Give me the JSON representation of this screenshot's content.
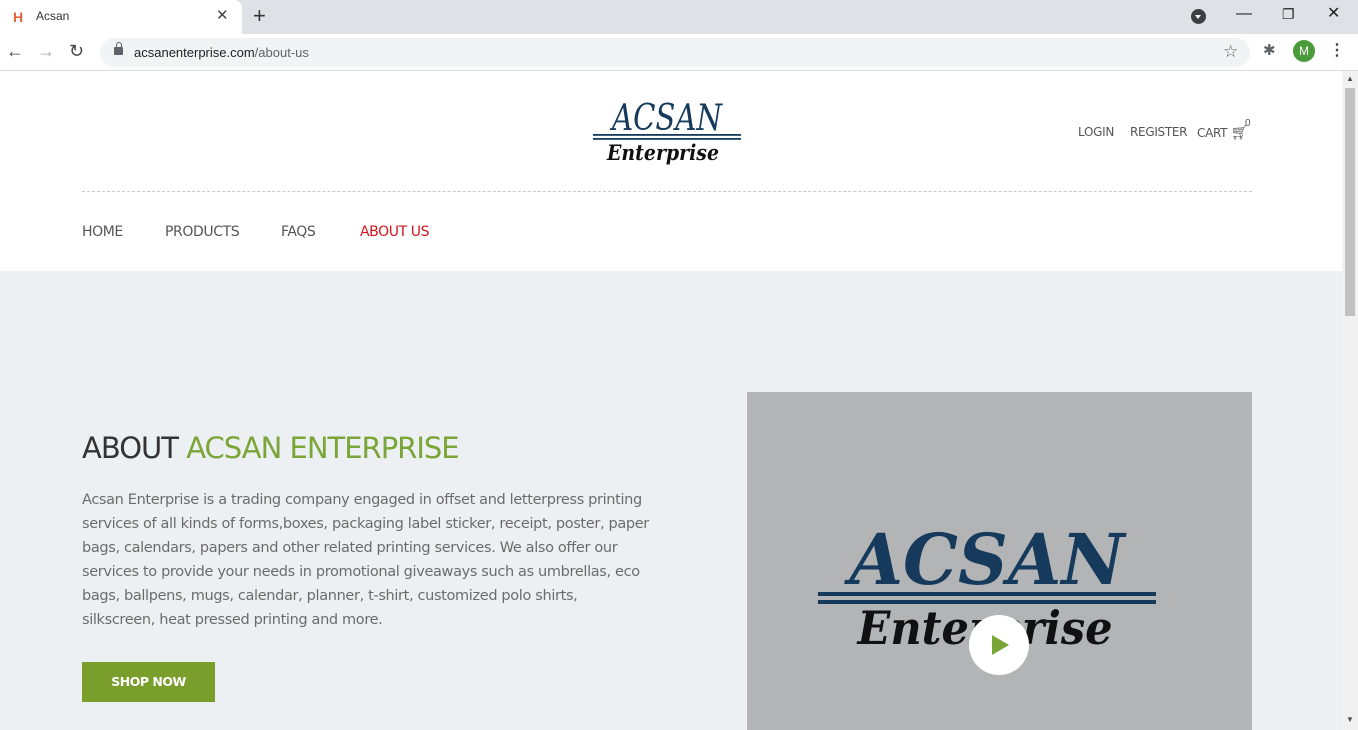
{
  "browser": {
    "tab_title": "Acsan",
    "url_host": "acsanenterprise.com",
    "url_path": "/about-us",
    "profile_initial": "M"
  },
  "header": {
    "logo_top": "ACSAN",
    "logo_bottom": "Enterprise",
    "login": "LOGIN",
    "register": "REGISTER",
    "cart": "CART",
    "cart_count": "0"
  },
  "nav": {
    "items": [
      "HOME",
      "PRODUCTS",
      "FAQS",
      "ABOUT US"
    ],
    "active": "ABOUT US"
  },
  "about": {
    "title_prefix": "ABOUT ",
    "title_highlight": "ACSAN ENTERPRISE",
    "paragraph": "Acsan Enterprise is a trading company engaged in offset and letterpress printing services of all kinds of forms,boxes, packaging label sticker, receipt, poster, paper bags, calendars, papers and other related printing services. We also offer our services to provide your needs in promotional giveaways such as umbrellas, eco bags, ballpens, mugs, calendar, planner, t-shirt, customized polo shirts, silkscreen, heat pressed printing and more.",
    "button": "SHOP NOW"
  },
  "video": {
    "logo_top": "ACSAN",
    "logo_bottom": "Enterprise"
  },
  "colors": {
    "accent_green": "#7aa537",
    "button_green": "#7a9e2b",
    "active_red": "#d0131b",
    "logo_navy": "#163a5c",
    "hero_bg": "#edf0f2"
  },
  "icons": [
    "favicon-icon",
    "close-icon",
    "plus-icon",
    "back-icon",
    "forward-icon",
    "reload-icon",
    "lock-icon",
    "star-icon",
    "extensions-icon",
    "menu-icon",
    "cart-icon",
    "play-icon"
  ]
}
